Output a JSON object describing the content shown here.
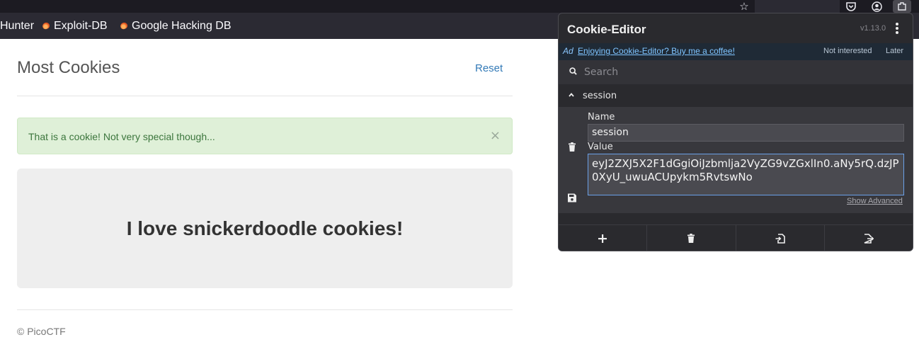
{
  "bookmarks": {
    "items": [
      {
        "label": "Hunter",
        "icon": "none"
      },
      {
        "label": "Exploit-DB",
        "icon": "flame-icon"
      },
      {
        "label": "Google Hacking DB",
        "icon": "flame-icon"
      }
    ]
  },
  "toolbar": {
    "icons": [
      "star-icon",
      "pocket-icon",
      "account-icon",
      "extensions-icon"
    ]
  },
  "page": {
    "title": "Most Cookies",
    "reset": "Reset",
    "alert": "That is a cookie! Not very special though...",
    "alert_close": "×",
    "headline": "I love snickerdoodle cookies!",
    "footer": "© PicoCTF"
  },
  "cookie_editor": {
    "title": "Cookie-Editor",
    "version": "v1.13.0",
    "ad": {
      "tag": "Ad",
      "text": "Enjoying Cookie-Editor? Buy me a coffee!",
      "not_interested": "Not interested",
      "later": "Later"
    },
    "search_placeholder": "Search",
    "cookie": {
      "name": "session",
      "name_label": "Name",
      "value_label": "Value",
      "value": "eyJ2ZXJ5X2F1dGgiOiJzbmlja2VyZG9vZGxlIn0.aNy5rQ.dzJP0XyU_uwuACUpykm5RvtswNo",
      "show_advanced": "Show Advanced"
    },
    "footer_buttons": [
      "add-icon",
      "delete-all-icon",
      "import-icon",
      "export-icon"
    ]
  },
  "colors": {
    "link_blue": "#337ab7",
    "alert_bg": "#dff0d8",
    "alert_text": "#3c763d",
    "popup_bg": "#2a2a2e",
    "value_focus_border": "#6aa0e8"
  }
}
